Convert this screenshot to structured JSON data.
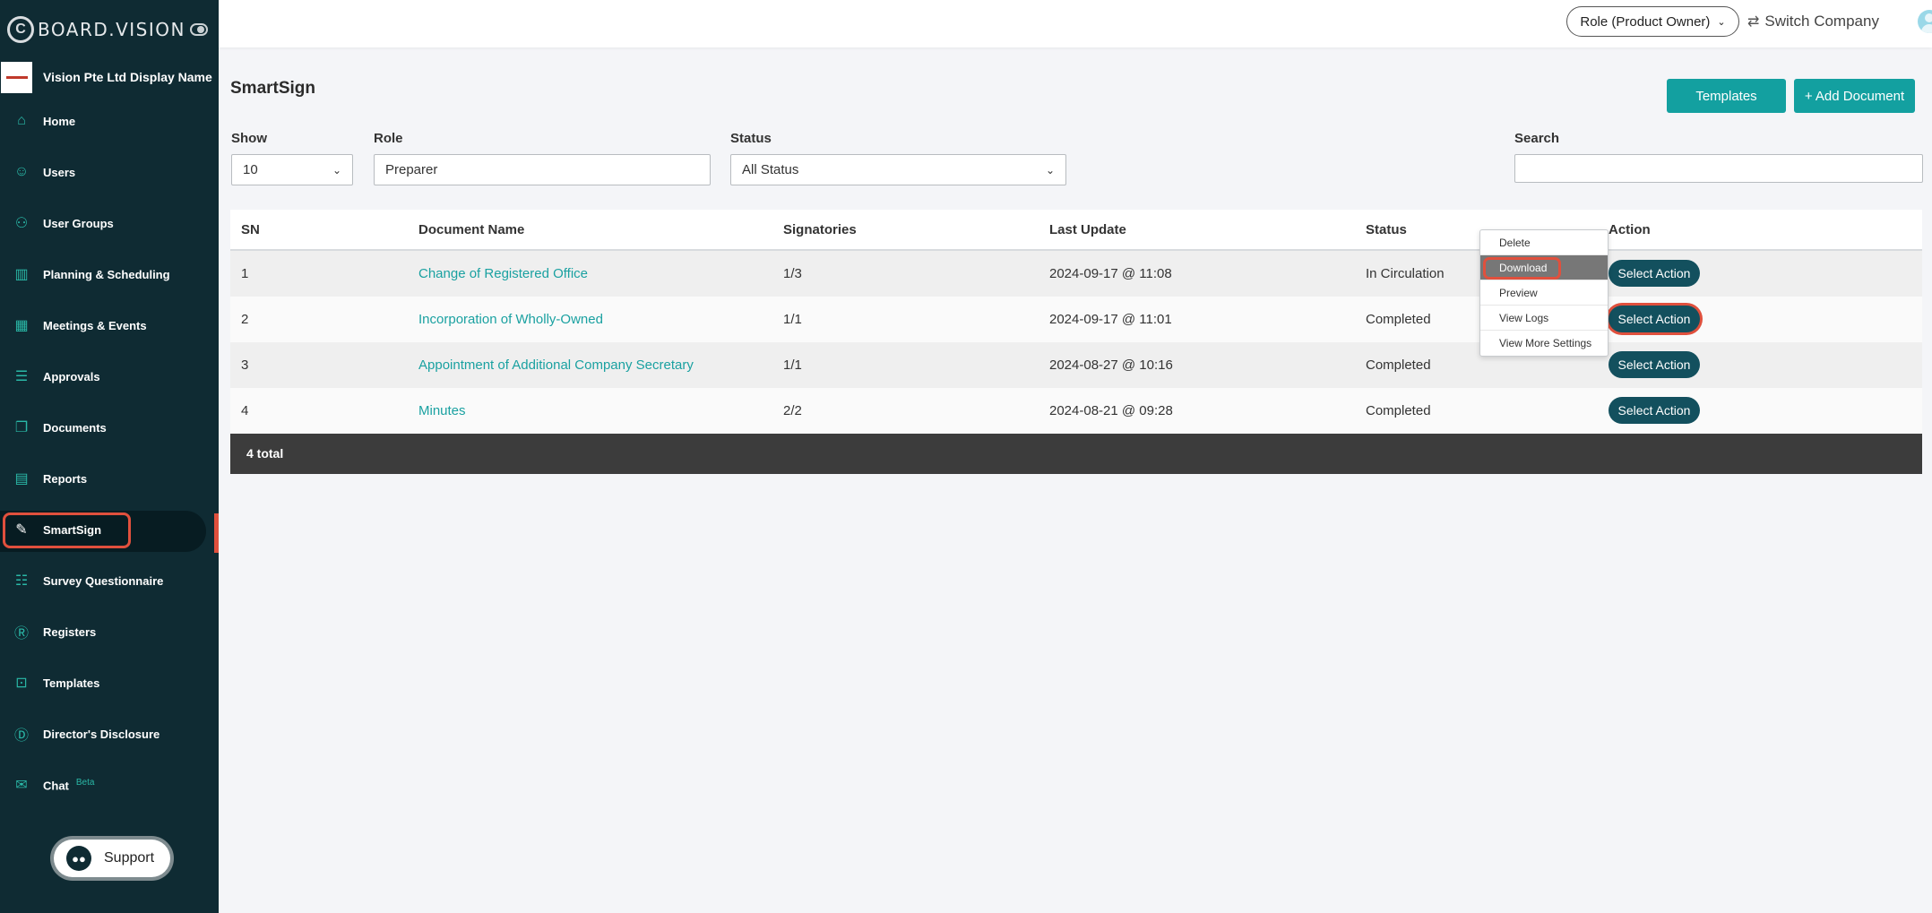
{
  "brand": {
    "name": "BOARD.VISION",
    "logo_letter": "C"
  },
  "company": {
    "name": "Vision Pte Ltd Display Name"
  },
  "nav": [
    {
      "label": "Home",
      "icon": "home-icon",
      "glyph": "⌂"
    },
    {
      "label": "Users",
      "icon": "user-icon",
      "glyph": "☺"
    },
    {
      "label": "User Groups",
      "icon": "user-groups-icon",
      "glyph": "⚇"
    },
    {
      "label": "Planning & Scheduling",
      "icon": "planning-icon",
      "glyph": "▥"
    },
    {
      "label": "Meetings & Events",
      "icon": "calendar-icon",
      "glyph": "▦"
    },
    {
      "label": "Approvals",
      "icon": "approvals-icon",
      "glyph": "☰"
    },
    {
      "label": "Documents",
      "icon": "documents-icon",
      "glyph": "❐"
    },
    {
      "label": "Reports",
      "icon": "reports-icon",
      "glyph": "▤"
    },
    {
      "label": "SmartSign",
      "icon": "pen-icon",
      "glyph": "✎"
    },
    {
      "label": "Survey Questionnaire",
      "icon": "survey-icon",
      "glyph": "☷"
    },
    {
      "label": "Registers",
      "icon": "registers-icon",
      "glyph": "Ⓡ"
    },
    {
      "label": "Templates",
      "icon": "templates-icon",
      "glyph": "⊡"
    },
    {
      "label": "Director's Disclosure",
      "icon": "disclosure-icon",
      "glyph": "Ⓓ"
    },
    {
      "label": "Chat",
      "icon": "chat-icon",
      "glyph": "✉",
      "badge": "Beta"
    }
  ],
  "support": {
    "label": "Support",
    "icon": "chat-bubble-icon"
  },
  "topbar": {
    "role": "Role (Product Owner)",
    "switch_company": "Switch Company"
  },
  "page": {
    "title": "SmartSign",
    "templates_button": "Templates",
    "add_document_button": "+ Add Document"
  },
  "filters": {
    "show_label": "Show",
    "show_value": "10",
    "role_label": "Role",
    "role_value": "Preparer",
    "status_label": "Status",
    "status_value": "All Status",
    "search_label": "Search",
    "search_value": ""
  },
  "table": {
    "columns": [
      "SN",
      "Document Name",
      "Signatories",
      "Last Update",
      "Status",
      "Action"
    ],
    "rows": [
      {
        "sn": "1",
        "name": "Change of Registered Office",
        "signatories": "1/3",
        "last_update": "2024-09-17 @ 11:08",
        "status": "In Circulation",
        "action": "Select Action"
      },
      {
        "sn": "2",
        "name": "Incorporation of Wholly-Owned",
        "signatories": "1/1",
        "last_update": "2024-09-17 @ 11:01",
        "status": "Completed",
        "action": "Select Action"
      },
      {
        "sn": "3",
        "name": "Appointment of Additional Company Secretary",
        "signatories": "1/1",
        "last_update": "2024-08-27 @ 10:16",
        "status": "Completed",
        "action": "Select Action"
      },
      {
        "sn": "4",
        "name": "Minutes",
        "signatories": "2/2",
        "last_update": "2024-08-21 @ 09:28",
        "status": "Completed",
        "action": "Select Action"
      }
    ],
    "total": "4 total"
  },
  "action_menu": {
    "items": [
      "Delete",
      "Download",
      "Preview",
      "View Logs",
      "View More Settings"
    ],
    "selected": "Download"
  },
  "colors": {
    "sidebar_bg": "#0f2b33",
    "accent_teal": "#13a0a0",
    "action_button": "#13505e",
    "highlight": "#e0503d"
  }
}
